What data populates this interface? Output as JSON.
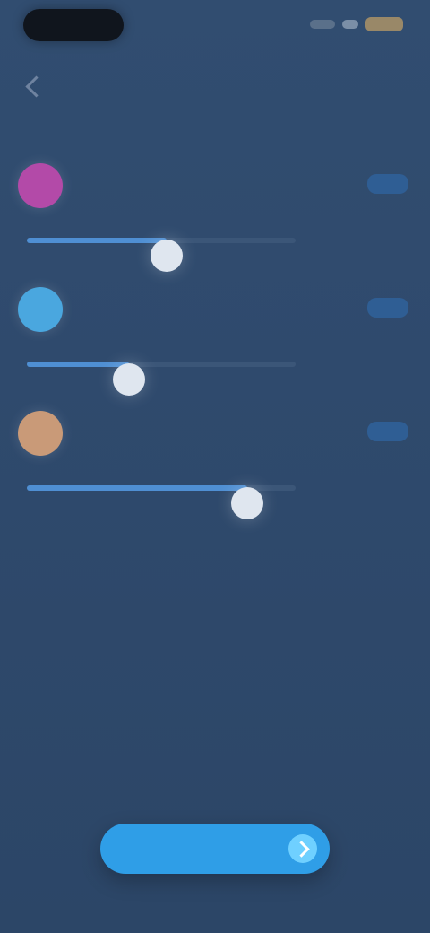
{
  "status_bar": {
    "time": "",
    "icons": [
      "signal-icon",
      "wifi-icon",
      "battery-icon"
    ]
  },
  "header": {
    "title": "",
    "subtitle": "",
    "back_icon": "back-icon"
  },
  "permissions": [
    {
      "title": "",
      "subtitle": "",
      "action_label": "",
      "color": "#b34aa8",
      "level_percent": 52,
      "left_label": "",
      "value_label": ""
    },
    {
      "title": "",
      "subtitle": "",
      "action_label": "",
      "color": "#4aa7df",
      "level_percent": 38,
      "left_label": "",
      "value_label": ""
    },
    {
      "title": "",
      "subtitle": "",
      "action_label": "",
      "color": "#c99a78",
      "level_percent": 82,
      "left_label": "",
      "value_label": ""
    }
  ],
  "primary_button": {
    "label": "",
    "icon": "arrow-right-icon",
    "color": "#2f9ee7"
  },
  "colors": {
    "background": "#2f4a6d",
    "accent": "#4f8fd3"
  }
}
